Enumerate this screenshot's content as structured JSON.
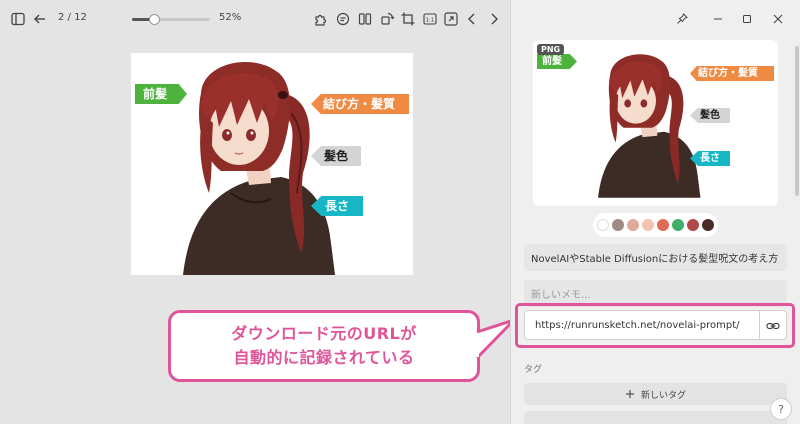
{
  "toolbar": {
    "page_counter": "2 / 12",
    "zoom_label": "52%",
    "zoom_fraction": 0.52
  },
  "image_labels": {
    "bangs": "前髪",
    "tie": "結び方・髪質",
    "color": "髪色",
    "length": "長さ"
  },
  "callout": {
    "line1": "ダウンロード元のURLが",
    "line2": "自動的に記録されている"
  },
  "panel": {
    "badge": "PNG",
    "swatch_colors": [
      "#ffffff",
      "#a08982",
      "#e0a99a",
      "#f5c4b0",
      "#e06a55",
      "#3fae6a",
      "#b04a48",
      "#4a2b2a"
    ],
    "title_value": "NovelAIやStable Diffusionにおける髪型呪文の考え方",
    "memo_placeholder": "新しいメモ...",
    "url_value": "https://runrunsketch.net/novelai-prompt/",
    "tags_heading": "タグ",
    "new_tag_label": "新しいタグ",
    "help_label": "?"
  },
  "colors": {
    "accent_pink": "#e0559a",
    "label_green": "#4db33d",
    "label_orange": "#ef8a43",
    "label_gray": "#d4d4d4",
    "label_teal": "#17b6c4"
  }
}
